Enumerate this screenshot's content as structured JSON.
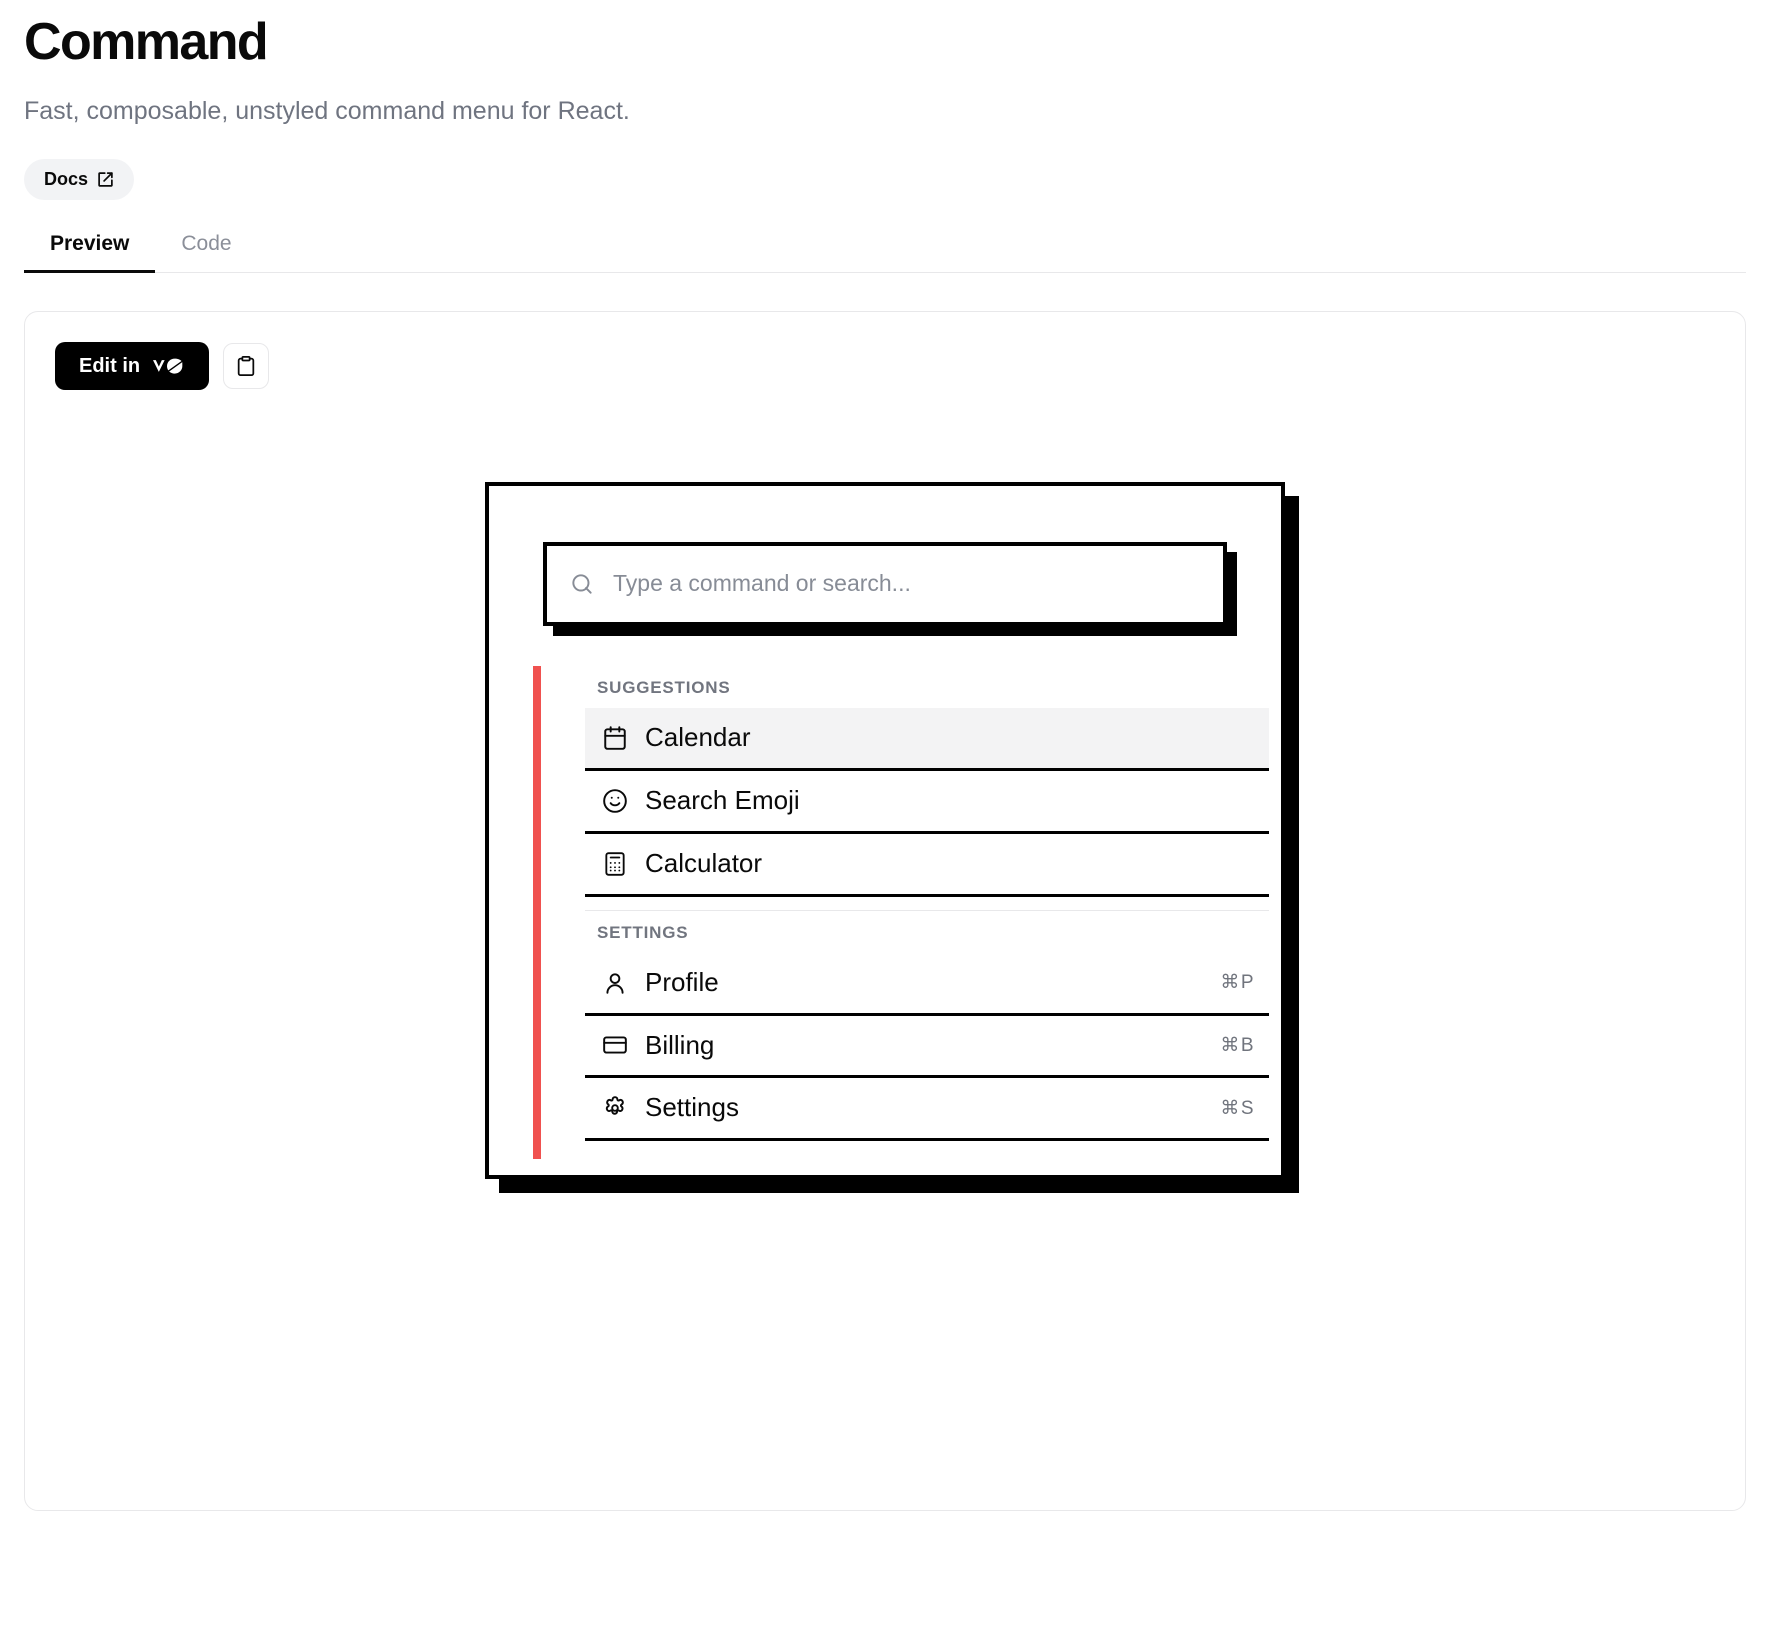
{
  "header": {
    "title": "Command",
    "subtitle": "Fast, composable, unstyled command menu for React.",
    "docs_label": "Docs",
    "docs_icon": "external-link-icon"
  },
  "tabs": [
    {
      "label": "Preview",
      "active": true
    },
    {
      "label": "Code",
      "active": false
    }
  ],
  "toolbar": {
    "edit_label": "Edit in",
    "edit_brand": "v0",
    "edit_icon": "v0-logo-icon",
    "copy_icon": "clipboard-icon"
  },
  "command": {
    "search_icon": "search-icon",
    "search_value": "",
    "search_placeholder": "Type a command or search...",
    "accent_color": "#f0514f",
    "groups": [
      {
        "heading": "SUGGESTIONS",
        "items": [
          {
            "icon": "calendar-icon",
            "label": "Calendar",
            "shortcut": "",
            "selected": true
          },
          {
            "icon": "smile-icon",
            "label": "Search Emoji",
            "shortcut": "",
            "selected": false
          },
          {
            "icon": "calculator-icon",
            "label": "Calculator",
            "shortcut": "",
            "selected": false
          }
        ]
      },
      {
        "heading": "SETTINGS",
        "items": [
          {
            "icon": "user-icon",
            "label": "Profile",
            "shortcut": "⌘P",
            "selected": false
          },
          {
            "icon": "credit-card-icon",
            "label": "Billing",
            "shortcut": "⌘B",
            "selected": false
          },
          {
            "icon": "gear-icon",
            "label": "Settings",
            "shortcut": "⌘S",
            "selected": false
          }
        ]
      }
    ]
  }
}
